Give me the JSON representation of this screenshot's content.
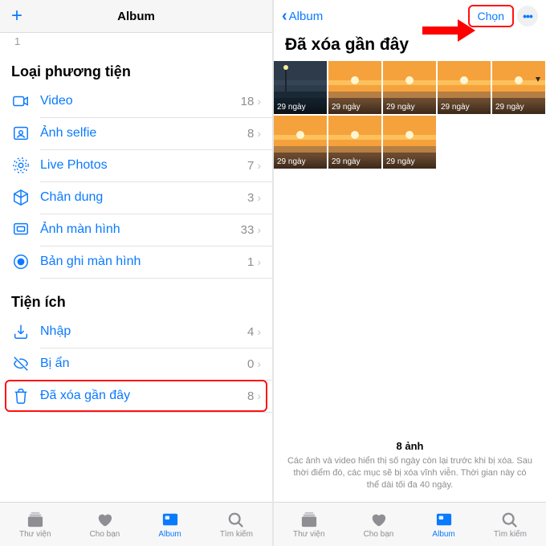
{
  "left": {
    "header_title": "Album",
    "sub": "1",
    "section_media": "Loại phương tiện",
    "media_items": [
      {
        "icon": "video",
        "label": "Video",
        "count": "18"
      },
      {
        "icon": "selfie",
        "label": "Ảnh selfie",
        "count": "8"
      },
      {
        "icon": "live",
        "label": "Live Photos",
        "count": "7"
      },
      {
        "icon": "cube",
        "label": "Chân dung",
        "count": "3"
      },
      {
        "icon": "screen",
        "label": "Ảnh màn hình",
        "count": "33"
      },
      {
        "icon": "rec",
        "label": "Bản ghi màn hình",
        "count": "1"
      }
    ],
    "section_util": "Tiện ích",
    "util_items": [
      {
        "icon": "import",
        "label": "Nhập",
        "count": "4"
      },
      {
        "icon": "hidden",
        "label": "Bị ẩn",
        "count": "0"
      },
      {
        "icon": "trash",
        "label": "Đã xóa gần đây",
        "count": "8",
        "highlight": true
      }
    ]
  },
  "right": {
    "back_label": "Album",
    "select_label": "Chọn",
    "title": "Đã xóa gần đây",
    "thumb_days": "29 ngày",
    "thumb_count": 8,
    "footer_count": "8 ảnh",
    "footer_msg": "Các ảnh và video hiển thị số ngày còn lại trước khi bị xóa. Sau thời điểm đó, các mục sẽ bị xóa vĩnh viễn. Thời gian này có thể dài tối đa 40 ngày."
  },
  "tabs": [
    {
      "label": "Thư viện",
      "icon": "lib"
    },
    {
      "label": "Cho bạn",
      "icon": "for"
    },
    {
      "label": "Album",
      "icon": "alb",
      "active": true
    },
    {
      "label": "Tìm kiếm",
      "icon": "search"
    }
  ]
}
